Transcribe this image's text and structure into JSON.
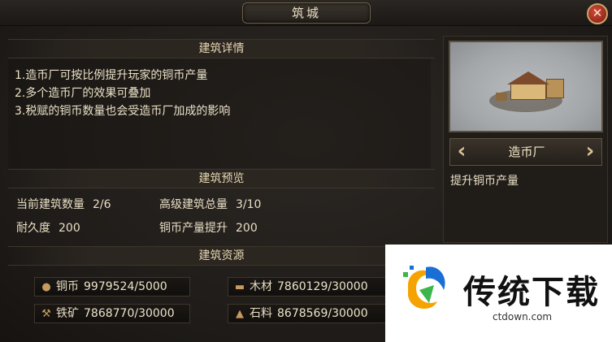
{
  "window": {
    "title": "筑城"
  },
  "detail": {
    "header": "建筑详情",
    "lines": [
      "1.造币厂可按比例提升玩家的铜币产量",
      "2.多个造币厂的效果可叠加",
      "3.税赋的铜币数量也会受造币厂加成的影响"
    ]
  },
  "preview": {
    "header": "建筑预览",
    "current_count_label": "当前建筑数量",
    "current_count_value": "2/6",
    "advanced_total_label": "高级建筑总量",
    "advanced_total_value": "3/10",
    "durability_label": "耐久度",
    "durability_value": "200",
    "copper_boost_label": "铜币产量提升",
    "copper_boost_value": "200"
  },
  "resources": {
    "header": "建筑资源",
    "items": [
      {
        "name": "铜币",
        "value": "9979524/5000",
        "icon": "copper-coin-icon"
      },
      {
        "name": "木材",
        "value": "7860129/30000",
        "icon": "wood-icon"
      },
      {
        "name": "铁矿",
        "value": "7868770/30000",
        "icon": "iron-ore-icon"
      },
      {
        "name": "石料",
        "value": "8678569/30000",
        "icon": "stone-icon"
      }
    ]
  },
  "building": {
    "name": "造币厂",
    "description": "提升铜币产量"
  },
  "watermark": {
    "title": "传统下载",
    "url": "ctdown.com"
  },
  "colors": {
    "background": "#1d1a17",
    "text": "#ece2c8",
    "close_button": "#b8362a",
    "accent_gold": "#c9a766"
  }
}
